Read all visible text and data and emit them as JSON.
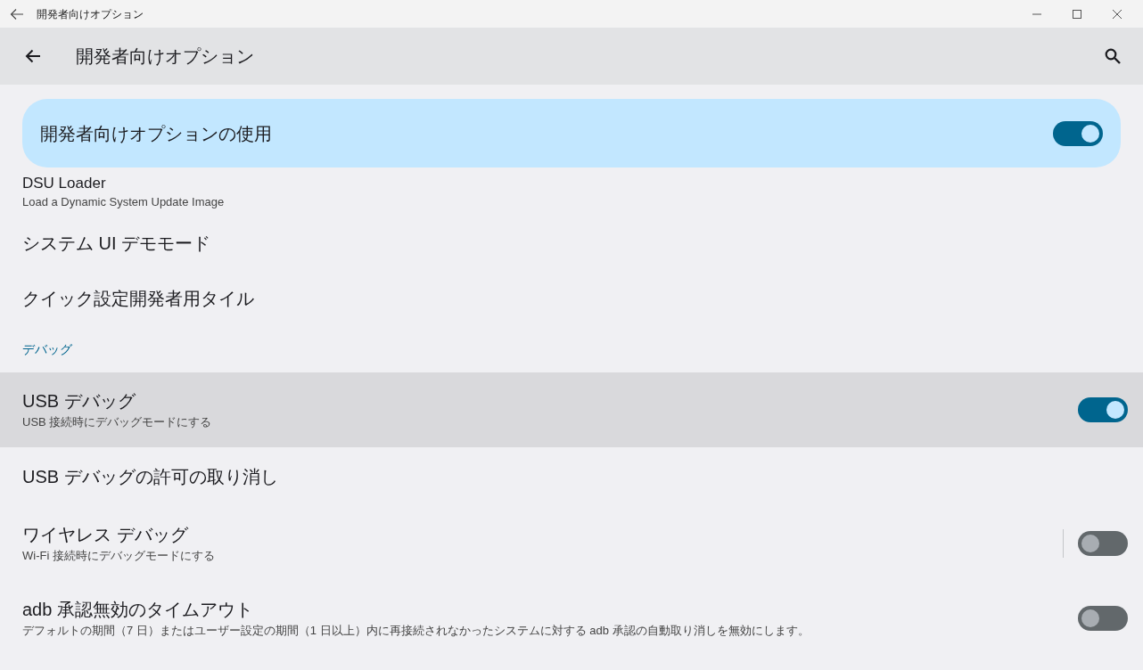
{
  "window": {
    "title": "開発者向けオプション"
  },
  "app_bar": {
    "title": "開発者向けオプション"
  },
  "master_switch": {
    "label": "開発者向けオプションの使用",
    "on": true
  },
  "items": [
    {
      "kind": "clipped",
      "title": "DSU Loader",
      "summary": "Load a Dynamic System Update Image"
    },
    {
      "kind": "single",
      "title": "システム UI デモモード"
    },
    {
      "kind": "single",
      "title": "クイック設定開発者用タイル"
    },
    {
      "kind": "header",
      "title": "デバッグ"
    },
    {
      "kind": "toggle",
      "title": "USB デバッグ",
      "summary": "USB 接続時にデバッグモードにする",
      "on": true,
      "highlighted": true,
      "split": false
    },
    {
      "kind": "single",
      "title": "USB デバッグの許可の取り消し"
    },
    {
      "kind": "toggle",
      "title": "ワイヤレス デバッグ",
      "summary": "Wi-Fi 接続時にデバッグモードにする",
      "on": false,
      "highlighted": false,
      "split": true
    },
    {
      "kind": "toggle",
      "title": "adb 承認無効のタイムアウト",
      "summary": "デフォルトの期間（7 日）またはユーザー設定の期間（1 日以上）内に再接続されなかったシステムに対する adb 承認の自動取り消しを無効にします。",
      "on": false,
      "highlighted": false,
      "split": false
    }
  ]
}
